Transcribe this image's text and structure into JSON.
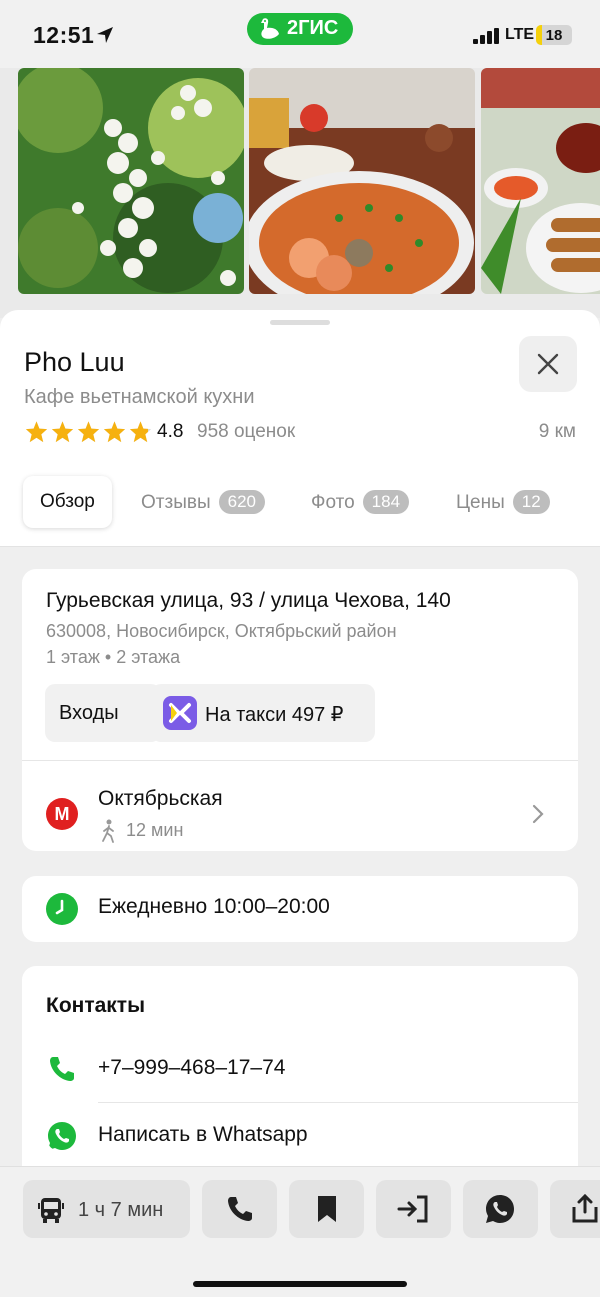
{
  "status_bar": {
    "time": "12:51",
    "network": "LTE",
    "battery": "18",
    "battery_level": 0.18
  },
  "brand": {
    "name": "2ГИС",
    "color": "#1db93c"
  },
  "place": {
    "name": "Pho Luu",
    "category": "Кафе вьетнамской кухни",
    "rating": "4.8",
    "rating_value": 4.8,
    "reviews": "958 оценок",
    "distance": "9 км"
  },
  "tabs": [
    {
      "label": "Обзор",
      "badge": ""
    },
    {
      "label": "Отзывы",
      "badge": "620"
    },
    {
      "label": "Фото",
      "badge": "184"
    },
    {
      "label": "Цены",
      "badge": "12"
    }
  ],
  "address": {
    "street": "Гурьевская улица, 93 / улица Чехова, 140",
    "city": "630008, Новосибирск, Октябрьский район",
    "floors": "1 этаж • 2 этажа",
    "entrances_label": "Входы",
    "taxi_label": "На такси 497 ₽"
  },
  "metro": {
    "icon_letter": "M",
    "station": "Октябрьская",
    "walk_time": "12 мин",
    "color": "#e02020"
  },
  "hours": {
    "text": "Ежедневно 10:00–20:00"
  },
  "contacts": {
    "title": "Контакты",
    "phone": "+7–999–468–17–74",
    "whatsapp": "Написать в Whatsapp"
  },
  "bottom_bar": {
    "route_time": "1 ч 7 мин"
  },
  "icons": [
    "location-arrow-icon",
    "goose-icon",
    "signal-icon",
    "close-icon",
    "star-icon",
    "taxi-icon",
    "metro-icon",
    "walk-icon",
    "chevron-right-icon",
    "clock-icon",
    "phone-icon",
    "whatsapp-icon",
    "bus-icon",
    "bookmark-icon",
    "enter-icon",
    "share-icon"
  ]
}
